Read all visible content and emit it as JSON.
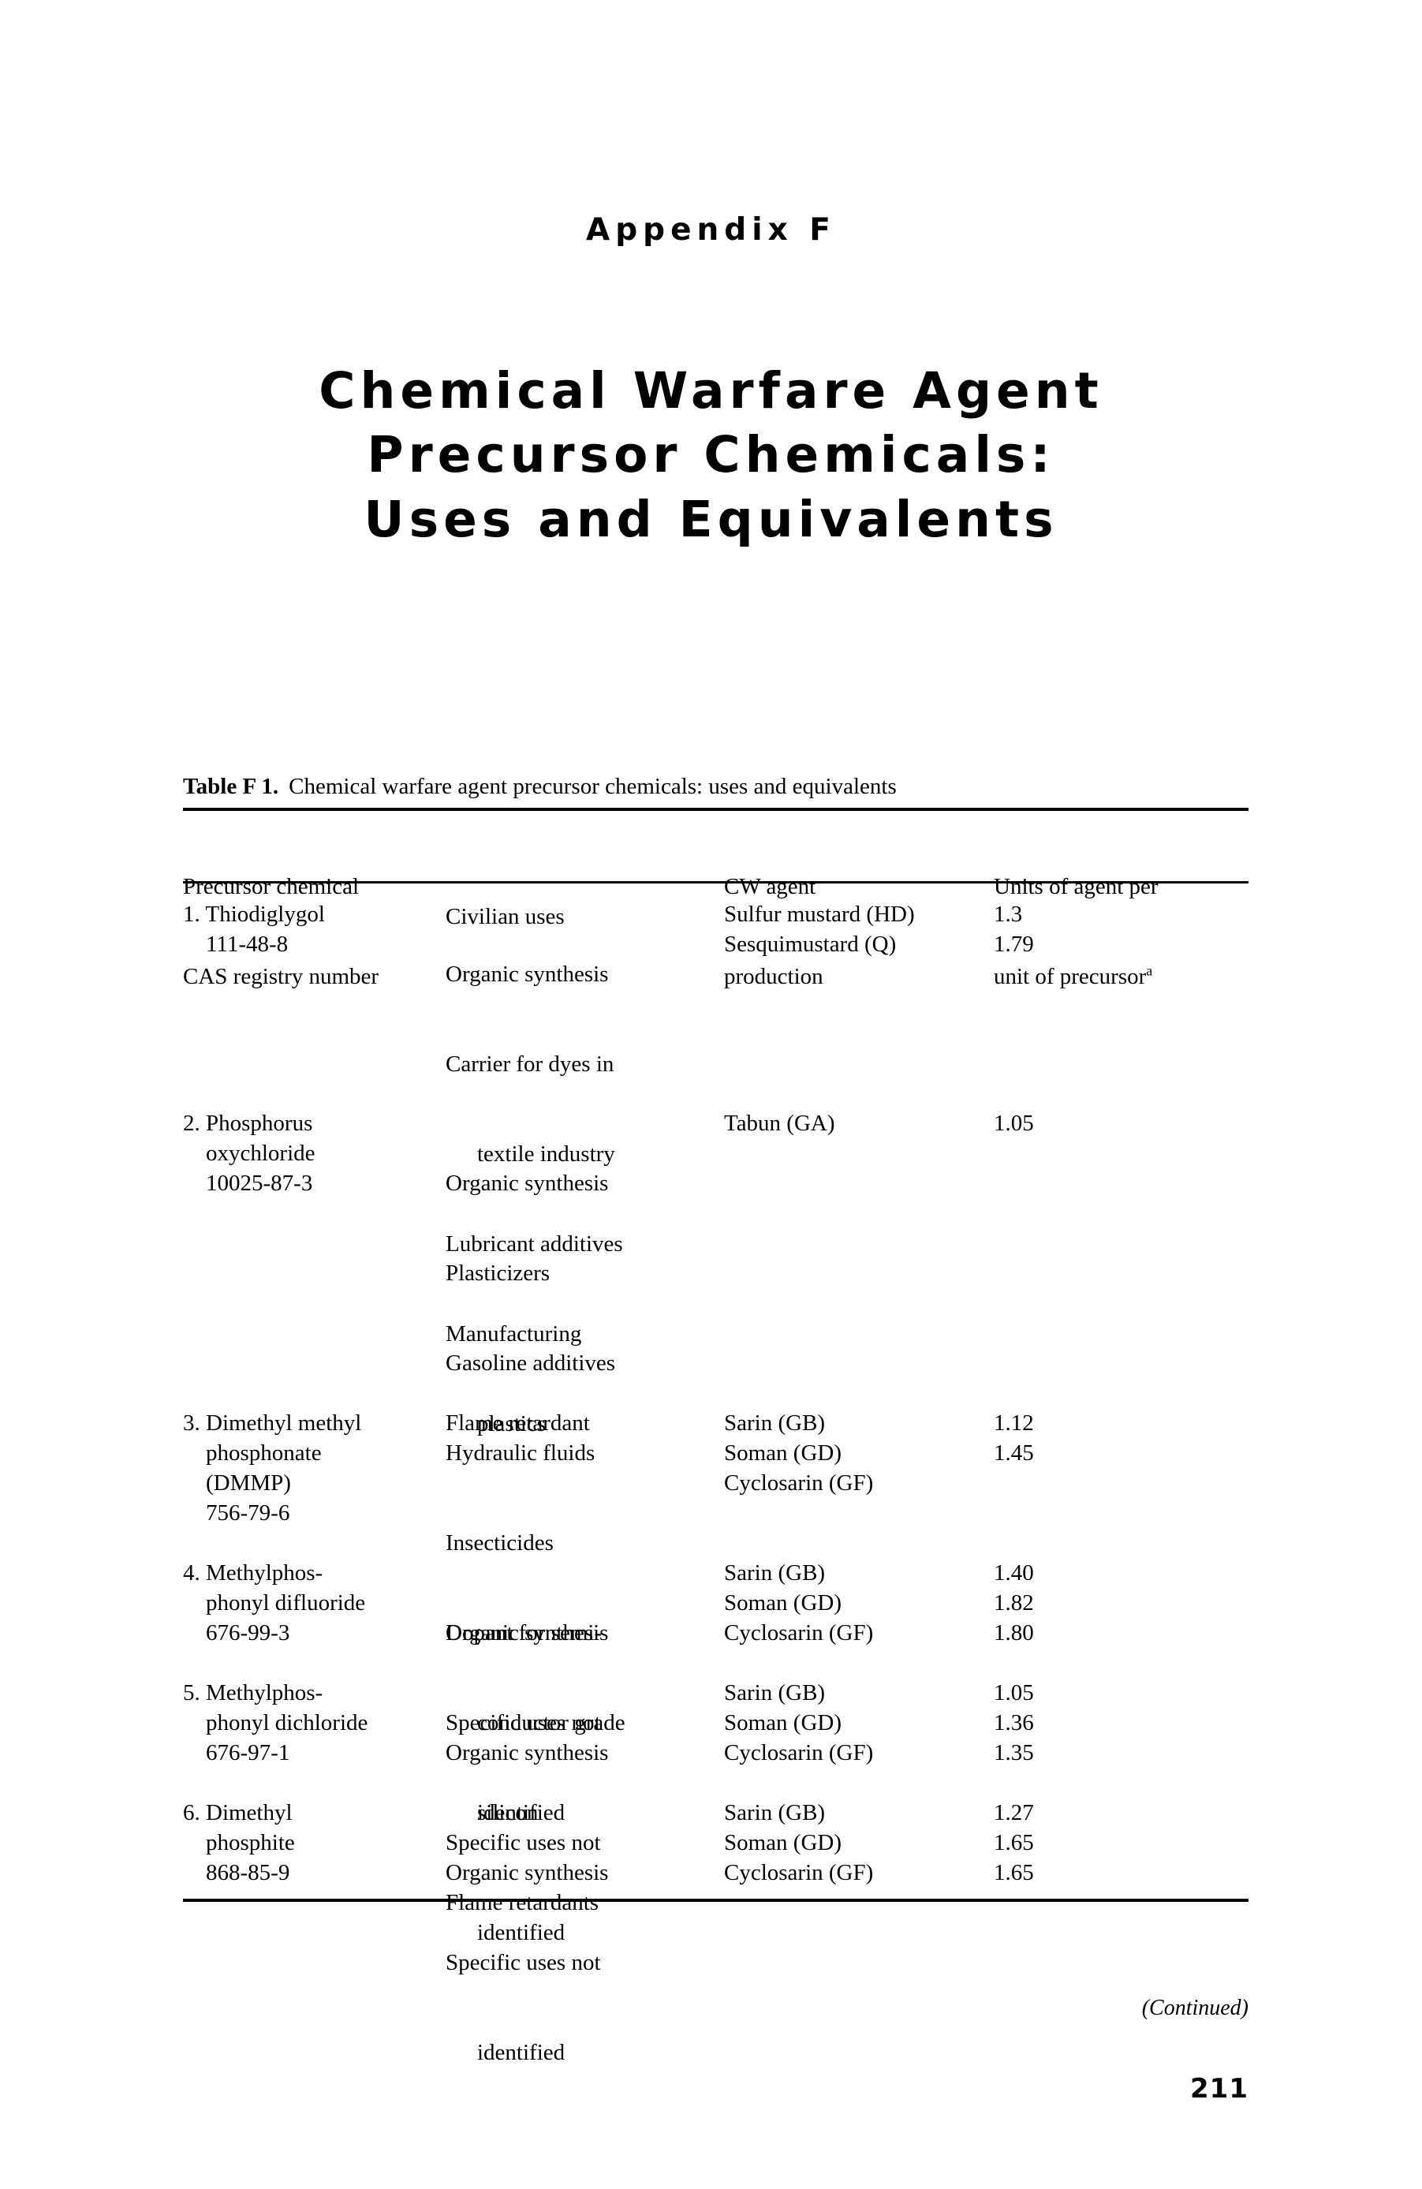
{
  "header": {
    "appendix_label": "Appendix F",
    "title_lines": [
      "Chemical Warfare Agent",
      "Precursor Chemicals:",
      "Uses and Equivalents"
    ]
  },
  "table": {
    "caption_strong": "Table F 1.",
    "caption_rest": "Chemical warfare agent precursor chemicals: uses and equivalents",
    "columns": [
      {
        "line1": "Precursor chemical",
        "line2": "CAS registry number"
      },
      {
        "line1": "",
        "line2": "Civilian uses"
      },
      {
        "line1": "CW agent",
        "line2": "production"
      },
      {
        "line1": "Units of agent per",
        "line2": "unit of precursor",
        "line2_sup": "a"
      }
    ],
    "rows": [
      {
        "precursor": [
          "1. Thiodiglygol",
          "111-48-8"
        ],
        "civilian_uses": [
          "Organic synthesis",
          "Carrier for dyes in textile industry",
          "Lubricant additives",
          "Manufacturing plastics"
        ],
        "cw_agents": [
          "Sulfur mustard (HD)",
          "Sesquimustard (Q)"
        ],
        "units": [
          "1.3",
          "1.79"
        ]
      },
      {
        "precursor": [
          "2. Phosphorus",
          "oxychloride",
          "10025-87-3"
        ],
        "civilian_uses": [
          "Organic synthesis",
          "Plasticizers",
          "Gasoline additives",
          "Hydraulic fluids",
          "Insecticides",
          "Dopant for semi-conductor grade silicon",
          "Flame retardants"
        ],
        "cw_agents": [
          "Tabun (GA)"
        ],
        "units": [
          "1.05"
        ]
      },
      {
        "precursor": [
          "3. Dimethyl methyl",
          "phosphonate",
          "(DMMP)",
          "756-79-6"
        ],
        "civilian_uses": [
          "Flame retardant"
        ],
        "cw_agents": [
          "Sarin (GB)",
          "Soman (GD)",
          "Cyclosarin (GF)"
        ],
        "units": [
          "1.12",
          "1.45"
        ]
      },
      {
        "precursor": [
          "4. Methylphos-",
          "phonyl difluoride",
          "676-99-3"
        ],
        "civilian_uses": [
          "Organic synthesis",
          "Specific uses not identified"
        ],
        "cw_agents": [
          "Sarin (GB)",
          "Soman (GD)",
          "Cyclosarin (GF)"
        ],
        "units": [
          "1.40",
          "1.82",
          "1.80"
        ]
      },
      {
        "precursor": [
          "5. Methylphos-",
          "phonyl dichloride",
          "676-97-1"
        ],
        "civilian_uses": [
          "Organic synthesis",
          "Specific uses not identified"
        ],
        "cw_agents": [
          "Sarin (GB)",
          "Soman (GD)",
          "Cyclosarin (GF)"
        ],
        "units": [
          "1.05",
          "1.36",
          "1.35"
        ]
      },
      {
        "precursor": [
          "6. Dimethyl",
          "phosphite",
          "868-85-9"
        ],
        "civilian_uses": [
          "Organic synthesis",
          "Specific uses not identified"
        ],
        "cw_agents": [
          "Sarin (GB)",
          "Soman (GD)",
          "Cyclosarin (GF)"
        ],
        "units": [
          "1.27",
          "1.65",
          "1.65"
        ]
      }
    ]
  },
  "footer": {
    "continued": "(Continued)",
    "page_number": "211"
  },
  "cell_text": {
    "r0c1": "1. Thiodiglygol\n    111-48-8",
    "r0c2_l1": "Organic synthesis",
    "r0c2_l2": "Carrier for dyes in",
    "r0c2_l3": "textile industry",
    "r0c2_l4": "Lubricant additives",
    "r0c2_l5": "Manufacturing",
    "r0c2_l6": "plastics",
    "r0c3": "Sulfur mustard (HD)\nSesquimustard (Q)",
    "r0c4": "1.3\n1.79",
    "r1c1": "2. Phosphorus\n    oxychloride\n    10025-87-3",
    "r1c2_l1": "Organic synthesis",
    "r1c2_l2": "Plasticizers",
    "r1c2_l3": "Gasoline additives",
    "r1c2_l4": "Hydraulic fluids",
    "r1c2_l5": "Insecticides",
    "r1c2_l6": "Dopant for semi-",
    "r1c2_l7": "conductor grade",
    "r1c2_l8": "silicon",
    "r1c2_l9": "Flame retardants",
    "r1c3": "Tabun (GA)",
    "r1c4": "1.05",
    "r2c1": "3. Dimethyl methyl\n    phosphonate\n    (DMMP)\n    756-79-6",
    "r2c2": "Flame retardant",
    "r2c3": "Sarin (GB)\nSoman (GD)\nCyclosarin (GF)",
    "r2c4": "1.12\n1.45",
    "r3c1": "4. Methylphos-\n    phonyl difluoride\n    676-99-3",
    "r3c2_l1": "Organic synthesis",
    "r3c2_l2": "Specific uses not",
    "r3c2_l3": "identified",
    "r3c3": "Sarin (GB)\nSoman (GD)\nCyclosarin (GF)",
    "r3c4": "1.40\n1.82\n1.80",
    "r4c1": "5. Methylphos-\n    phonyl dichloride\n    676-97-1",
    "r4c2_l1": "Organic synthesis",
    "r4c2_l2": "Specific uses not",
    "r4c2_l3": "identified",
    "r4c3": "Sarin (GB)\nSoman (GD)\nCyclosarin (GF)",
    "r4c4": "1.05\n1.36\n1.35",
    "r5c1": "6. Dimethyl\n    phosphite\n    868-85-9",
    "r5c2_l1": "Organic synthesis",
    "r5c2_l2": "Specific uses not",
    "r5c2_l3": "identified",
    "r5c3": "Sarin (GB)\nSoman (GD)\nCyclosarin (GF)",
    "r5c4": "1.27\n1.65\n1.65"
  }
}
